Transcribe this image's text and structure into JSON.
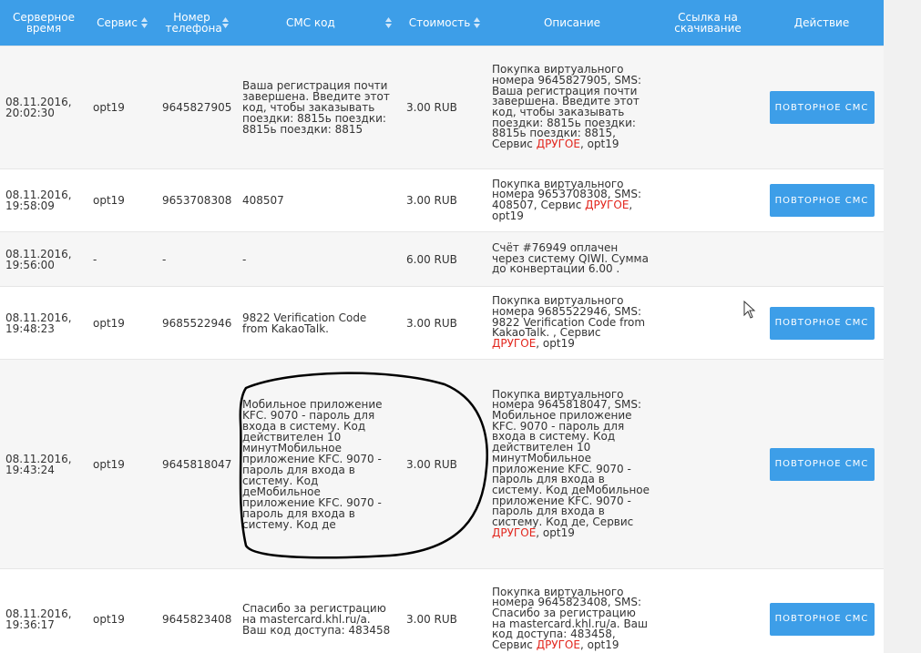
{
  "table": {
    "headers": {
      "time": "Серверное время",
      "service": "Сервис",
      "phone": "Номер телефона",
      "sms": "СМС код",
      "cost": "Стоимость",
      "description": "Описание",
      "download": "Ссылка на скачивание",
      "action": "Действие"
    },
    "rows": [
      {
        "time": "08.11.2016, 20:02:30",
        "service": "opt19",
        "phone": "9645827905",
        "sms": "Ваша регистрация почти завершена. Введите этот код, чтобы заказывать поездки: 8815ь поездки: 8815ь поездки: 8815",
        "cost": "3.00 RUB",
        "description": "Покупка виртуального номера 9645827905, SMS: Ваша регистрация почти завершена. Введите этот код, чтобы заказывать поездки: 8815ь поездки: 8815ь поездки: 8815, Сервис",
        "desc_red": "ДРУГОЕ",
        "desc_tail": ", opt19",
        "button": "Повторное СМС"
      },
      {
        "time": "08.11.2016, 19:58:09",
        "service": "opt19",
        "phone": "9653708308",
        "sms": "408507",
        "cost": "3.00 RUB",
        "description": "Покупка виртуального номера 9653708308, SMS: 408507, Сервис",
        "desc_red": "ДРУГОЕ",
        "desc_tail": ", opt19",
        "button": "Повторное СМС"
      },
      {
        "time": "08.11.2016, 19:56:00",
        "service": "-",
        "phone": "-",
        "sms": "-",
        "cost": "6.00 RUB",
        "description": "Счёт #76949 оплачен через систему QIWI. Сумма до конвертации 6.00 .",
        "desc_red": "",
        "desc_tail": "",
        "button": ""
      },
      {
        "time": "08.11.2016, 19:48:23",
        "service": "opt19",
        "phone": "9685522946",
        "sms": "9822 Verification Code from KakaoTalk.",
        "cost": "3.00 RUB",
        "description": "Покупка виртуального номера 9685522946, SMS: 9822 Verification Code from KakaoTalk. , Сервис",
        "desc_red": "ДРУГОЕ",
        "desc_tail": ", opt19",
        "button": "Повторное СМС"
      },
      {
        "time": "08.11.2016, 19:43:24",
        "service": "opt19",
        "phone": "9645818047",
        "sms": "Мобильное приложение KFC. 9070 - пароль для входа в систему. Код действителен 10 минутМобильное приложение KFC. 9070 - пароль для входа в систему. Код деМобильное приложение KFC. 9070 - пароль для входа в систему. Код де",
        "cost": "3.00 RUB",
        "description": "Покупка виртуального номера 9645818047, SMS: Мобильное приложение KFC. 9070 - пароль для входа в систему. Код действителен 10 минутМобильное приложение KFC. 9070 - пароль для входа в систему. Код деМобильное приложение KFC. 9070 - пароль для входа в систему. Код де, Сервис",
        "desc_red": "ДРУГОЕ",
        "desc_tail": ", opt19",
        "button": "Повторное СМС"
      },
      {
        "time": "08.11.2016, 19:36:17",
        "service": "opt19",
        "phone": "9645823408",
        "sms": "Спасибо за регистрацию на mastercard.khl.ru/a. Ваш код доступа: 483458",
        "cost": "3.00 RUB",
        "description": "Покупка виртуального номера 9645823408, SMS: Спасибо за регистрацию на mastercard.khl.ru/a. Ваш код доступа: 483458, Сервис",
        "desc_red": "ДРУГОЕ",
        "desc_tail": ", opt19",
        "button": "Повторное СМС"
      }
    ]
  },
  "icons": {
    "sort": "sort-arrows-icon",
    "cursor": "mouse-pointer-icon"
  },
  "colors": {
    "header_bg": "#3d9ee8",
    "button_bg": "#3d9ee8",
    "accent_red": "#e2261d"
  }
}
